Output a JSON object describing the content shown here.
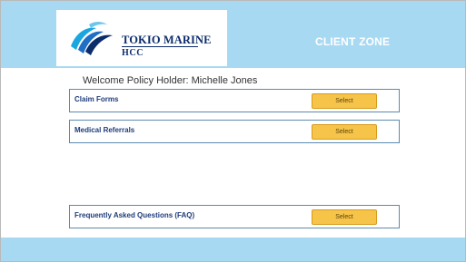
{
  "header": {
    "brand_top": "TOKIO MARINE",
    "brand_bottom": "HCC",
    "title": "CLIENT ZONE"
  },
  "welcome_text": "Welcome Policy Holder: Michelle Jones",
  "rows": [
    {
      "label": "Claim Forms",
      "button": "Select"
    },
    {
      "label": "Medical Referrals",
      "button": "Select"
    },
    {
      "label": "Frequently Asked Questions (FAQ)",
      "button": "Select"
    }
  ],
  "colors": {
    "header_bg": "#a8d9f2",
    "button_bg": "#f7c44a",
    "label_text": "#1e3c7a"
  }
}
